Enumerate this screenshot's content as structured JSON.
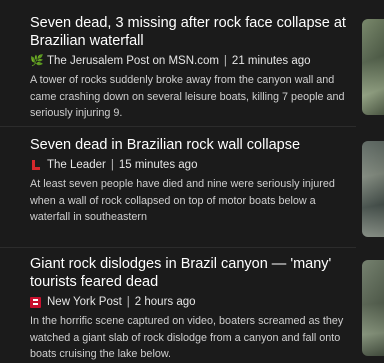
{
  "articles": [
    {
      "headline": "Seven dead, 3 missing after rock face collapse at Brazilian waterfall",
      "source": "The Jerusalem Post on MSN.com",
      "time": "21 minutes ago",
      "logo_icon": "jerusalem-post-logo-icon",
      "snippet": "A tower of rocks suddenly broke away from the canyon wall and came crashing down on several leisure boats, killing 7 people and seriously injuring 9."
    },
    {
      "headline": "Seven dead in Brazilian rock wall collapse",
      "source": "The Leader",
      "time": "15 minutes ago",
      "logo_icon": "the-leader-logo-icon",
      "snippet": "At least seven people have died and nine were seriously injured when a wall of rock collapsed on top of motor boats below a waterfall in southeastern"
    },
    {
      "headline": "Giant rock dislodges in Brazil canyon — 'many' tourists feared dead",
      "source": "New York Post",
      "time": "2 hours ago",
      "logo_icon": "new-york-post-logo-icon",
      "snippet": "In the horrific scene captured on video, boaters screamed as they watched a giant slab of rock dislodge from a canyon and fall onto boats cruising the lake below."
    }
  ],
  "separator": "|",
  "colors": {
    "background": "#1b1b1b",
    "headline": "#ffffff",
    "snippet": "#cfcfcf",
    "leader_brand": "#d6282c",
    "nypost_brand": "#c8102e"
  }
}
